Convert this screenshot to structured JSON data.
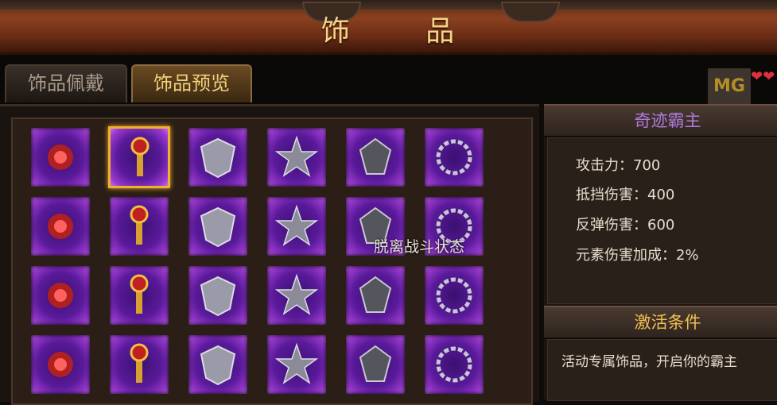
{
  "window": {
    "title": "饰 品"
  },
  "tabs": [
    {
      "label": "饰品佩戴",
      "active": false
    },
    {
      "label": "饰品预览",
      "active": true
    }
  ],
  "grid": {
    "items": [
      {
        "icon": "ruby-earrings-icon",
        "selected": false
      },
      {
        "icon": "golden-scepter-icon",
        "selected": true
      },
      {
        "icon": "silver-shield-amulet-icon",
        "selected": false
      },
      {
        "icon": "spiked-star-emblem-icon",
        "selected": false
      },
      {
        "icon": "dark-crest-icon",
        "selected": false
      },
      {
        "icon": "thorn-wreath-icon",
        "selected": false
      },
      {
        "icon": "silver-chalice-icon",
        "selected": false
      },
      {
        "icon": "winged-orb-icon",
        "selected": false
      },
      {
        "icon": "iron-goblet-icon",
        "selected": false
      },
      {
        "icon": "crested-shield-icon",
        "selected": false
      },
      {
        "icon": "claw-bracer-icon",
        "selected": false
      },
      {
        "icon": "braided-ring-icon",
        "selected": false
      },
      {
        "icon": "charm-necklace-icon",
        "selected": false
      },
      {
        "icon": "dragon-head-icon",
        "selected": false
      },
      {
        "icon": "horned-helm-icon",
        "selected": false
      },
      {
        "icon": "spiked-wheel-icon",
        "selected": false
      },
      {
        "icon": "faceted-gem-wand-icon",
        "selected": false
      },
      {
        "icon": "beast-mask-icon",
        "selected": false
      },
      {
        "icon": "steel-gauntlet-icon",
        "selected": false
      },
      {
        "icon": "hooded-cloak-icon",
        "selected": false
      },
      {
        "icon": "demon-mask-icon",
        "selected": false
      },
      {
        "icon": "laurel-v-medal-icon",
        "selected": false
      },
      {
        "icon": "v-emblem-badge-icon",
        "selected": false
      },
      {
        "icon": "dark-heart-icon",
        "selected": false
      }
    ],
    "tooltip": "脱离战斗状态"
  },
  "details": {
    "name": "奇迹霸主",
    "stats": [
      "攻击力：700",
      "抵挡伤害：400",
      "反弹伤害：600",
      "元素伤害加成：2%"
    ],
    "condition_header": "激活条件",
    "condition_text": "活动专属饰品，开启你的霸主"
  },
  "watermark": {
    "logo": "MG"
  },
  "colors": {
    "title_gold": "#f4d48a",
    "name_purple": "#b07ae0",
    "header_gold": "#f2c050",
    "slot_purple": "#9a3ad0",
    "select_gold": "#f0b030"
  }
}
